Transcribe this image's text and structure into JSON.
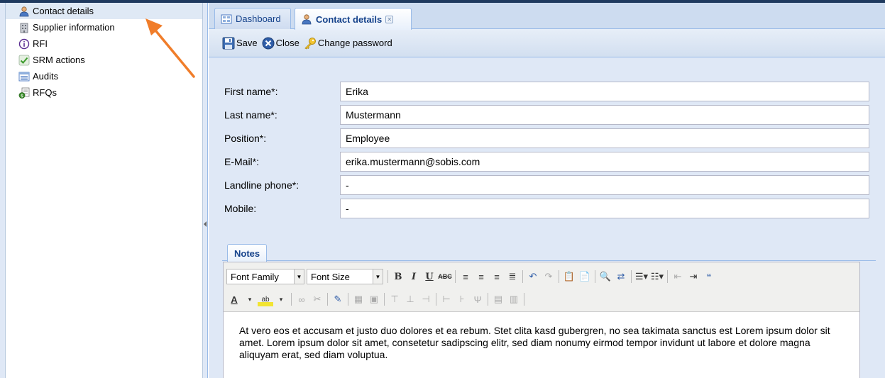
{
  "sidebar": {
    "items": [
      {
        "label": "Contact details",
        "icon": "user-icon",
        "active": true
      },
      {
        "label": "Supplier information",
        "icon": "building-icon"
      },
      {
        "label": "RFI",
        "icon": "info-icon"
      },
      {
        "label": "SRM actions",
        "icon": "checkmark-icon"
      },
      {
        "label": "Audits",
        "icon": "list-icon"
      },
      {
        "label": "RFQs",
        "icon": "document-money-icon"
      }
    ]
  },
  "tabs": [
    {
      "label": "Dashboard",
      "icon": "dashboard-icon"
    },
    {
      "label": "Contact details",
      "icon": "user-icon",
      "active": true
    }
  ],
  "toolbar": {
    "save_label": "Save",
    "close_label": "Close",
    "change_password_label": "Change password"
  },
  "form": {
    "fields": [
      {
        "label": "First name*:",
        "value": "Erika"
      },
      {
        "label": "Last name*:",
        "value": "Mustermann"
      },
      {
        "label": "Position*:",
        "value": "Employee"
      },
      {
        "label": "E-Mail*:",
        "value": "erika.mustermann@sobis.com"
      },
      {
        "label": "Landline phone*:",
        "value": "-"
      },
      {
        "label": "Mobile:",
        "value": "-"
      }
    ]
  },
  "notes": {
    "tab_label": "Notes",
    "font_family_label": "Font Family",
    "font_size_label": "Font Size",
    "content": "At vero eos et accusam et justo duo dolores et ea rebum. Stet clita kasd gubergren, no sea takimata sanctus est Lorem ipsum dolor sit amet. Lorem ipsum dolor sit amet, consetetur sadipscing elitr, sed diam nonumy eirmod tempor invidunt ut labore et dolore magna aliquyam erat, sed diam voluptua."
  },
  "colors": {
    "annotation_arrow": "#f07d2a",
    "accent": "#15428b",
    "panel_bg": "#dfe8f6"
  }
}
